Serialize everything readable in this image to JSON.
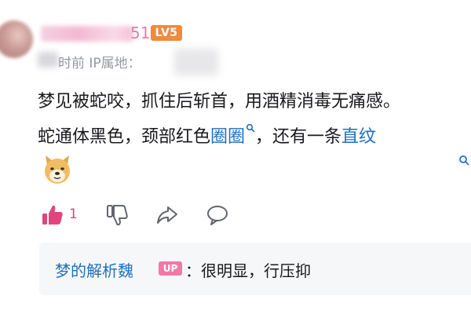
{
  "comment": {
    "username_suffix": "51",
    "level_badge": "LV5",
    "meta_text": "时前 IP属地：",
    "line1": "梦见被蛇咬，抓住后斩首，用酒精消毒无痛感。",
    "line2_prefix": "蛇通体黑色，颈部红色",
    "line2_link1": "圈圈",
    "line2_middle": "，还有一条",
    "line2_link2": "直纹",
    "like_count": "1",
    "emoji": "doge-face"
  },
  "icons": {
    "like": "thumbs-up-icon",
    "dislike": "thumbs-down-icon",
    "share": "share-icon",
    "reply": "comment-icon",
    "search": "search-icon"
  },
  "reply": {
    "author": "梦的解析魏",
    "badge": "UP",
    "text": "：很明显，行压抑"
  },
  "colors": {
    "link": "#1f6fbf",
    "like": "#e0467b",
    "level_badge": "#f08a3c",
    "up_badge": "#f07aa6",
    "meta": "#9499a0",
    "reply_bg": "#f6f7f8"
  }
}
